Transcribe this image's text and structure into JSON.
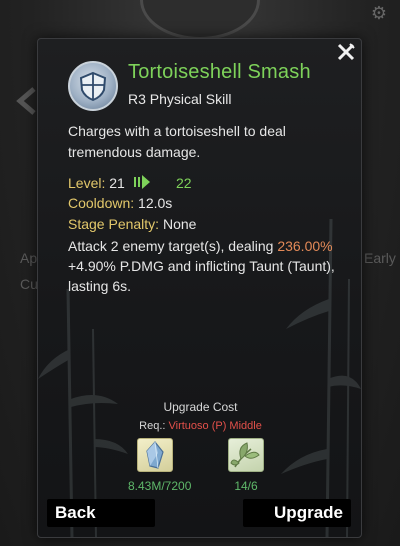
{
  "background": {
    "left_text_1": "Ap",
    "left_text_2": "Cu",
    "right_text": "Early",
    "gear_icon": "gear-icon"
  },
  "skill": {
    "name": "Tortoiseshell Smash",
    "type": "R3 Physical Skill",
    "description": "Charges with a tortoiseshell to deal tremendous damage.",
    "icon": "shield-icon",
    "name_color": "#7ed25a"
  },
  "stats": {
    "level_label": "Level:",
    "level_value": "21",
    "level_next": "22",
    "cooldown_label": "Cooldown:",
    "cooldown_value": "12.0s",
    "penalty_label": "Stage Penalty:",
    "penalty_value": "None"
  },
  "effect": {
    "part1": "Attack 2 enemy target(s), dealing ",
    "highlight": "236.00%",
    "part2": " +4.90% P.DMG and inflicting Taunt (Taunt), lasting 6s."
  },
  "upgrade": {
    "title": "Upgrade Cost",
    "req_label": "Req.:",
    "req_value": "Virtuoso (P) Middle",
    "items": [
      {
        "icon": "crystal-icon",
        "count": "8.43M/7200"
      },
      {
        "icon": "leaf-icon",
        "count": "14/6"
      }
    ]
  },
  "buttons": {
    "back": "Back",
    "upgrade": "Upgrade"
  }
}
